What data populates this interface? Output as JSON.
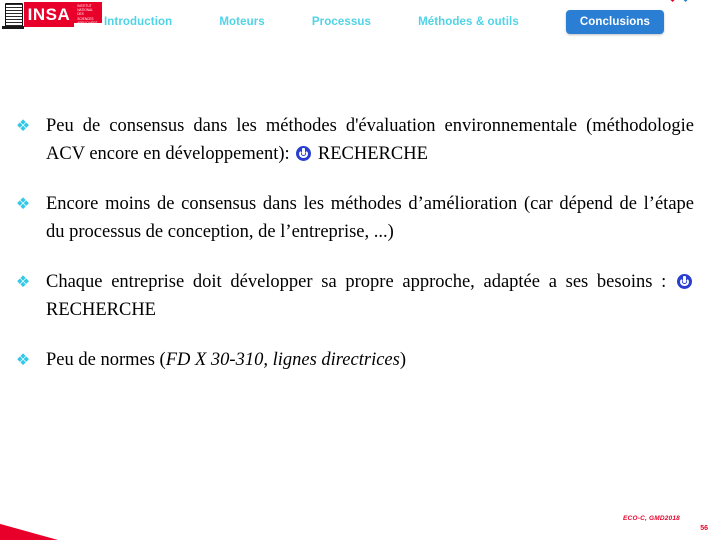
{
  "logo": {
    "seal_name": "insa-seal",
    "brand": "INSA",
    "brand_sub": "INSTITUT NATIONAL DES SCIENCES APPLIQUÉES DE LYON"
  },
  "nav": {
    "items": [
      {
        "label": "Introduction",
        "active": false
      },
      {
        "label": "Moteurs",
        "active": false
      },
      {
        "label": "Processus",
        "active": false
      },
      {
        "label": "Méthodes & outils",
        "active": false
      },
      {
        "label": "Conclusions",
        "active": true
      }
    ],
    "inactive_color": "#4fd3e6",
    "active_bg": "#2a7fd4",
    "active_color": "#ffffff"
  },
  "bullets": [
    {
      "marker": "❖",
      "parts": [
        {
          "type": "text",
          "value": "Peu de consensus dans les méthodes d'évaluation environnementale (méthodologie ACV encore en développement): "
        },
        {
          "type": "icon",
          "value": "power-icon"
        },
        {
          "type": "text",
          "value": " RECHERCHE"
        }
      ]
    },
    {
      "marker": "❖",
      "parts": [
        {
          "type": "text",
          "value": "Encore moins de consensus dans les méthodes d’amélioration (car dépend de l’étape du processus de conception, de l’entreprise, ...)"
        }
      ]
    },
    {
      "marker": "❖",
      "parts": [
        {
          "type": "text",
          "value": "Chaque entreprise doit développer sa propre approche, adaptée a ses besoins : "
        },
        {
          "type": "icon",
          "value": "power-icon"
        },
        {
          "type": "text",
          "value": " RECHERCHE"
        }
      ]
    },
    {
      "marker": "❖",
      "parts": [
        {
          "type": "text",
          "value": "Peu de normes ("
        },
        {
          "type": "italic",
          "value": "FD X 30-310, lignes directrices"
        },
        {
          "type": "text",
          "value": ")"
        }
      ]
    }
  ],
  "footer": {
    "reference": "ECO-C, GMD2018",
    "page_number": "56",
    "color": "#e8002a"
  }
}
